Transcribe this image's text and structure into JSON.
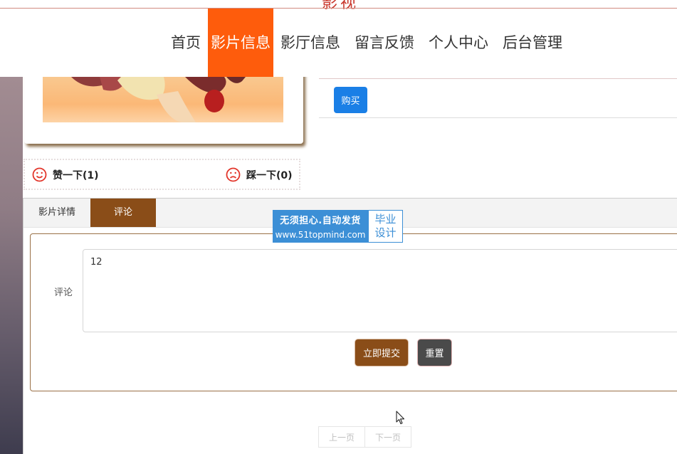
{
  "header": {
    "site_title": "影视",
    "nav": [
      "首页",
      "影片信息",
      "影厅信息",
      "留言反馈",
      "个人中心",
      "后台管理"
    ],
    "active_index": 1
  },
  "movie": {
    "buy_label": "购买",
    "like_label": "赞一下(1)",
    "dislike_label": "踩一下(0)"
  },
  "tabs": {
    "details_label": "影片详情",
    "comments_label": "评论"
  },
  "watermark": {
    "line1": "无须担心.自动发货",
    "line2": "www.51topmind.com",
    "badge_line1": "毕业",
    "badge_line2": "设计"
  },
  "comment_form": {
    "label": "评论",
    "value": "12",
    "submit_label": "立即提交",
    "reset_label": "重置"
  },
  "pager": {
    "prev_label": "上一页",
    "next_label": "下一页"
  },
  "colors": {
    "nav_active": "#fe5c0c",
    "buy": "#1a7fe6",
    "brown_accent": "#8a4d18",
    "reset": "#4a4a4a",
    "watermark_blue": "#3c8fd6",
    "smiley": "#e2352a"
  }
}
